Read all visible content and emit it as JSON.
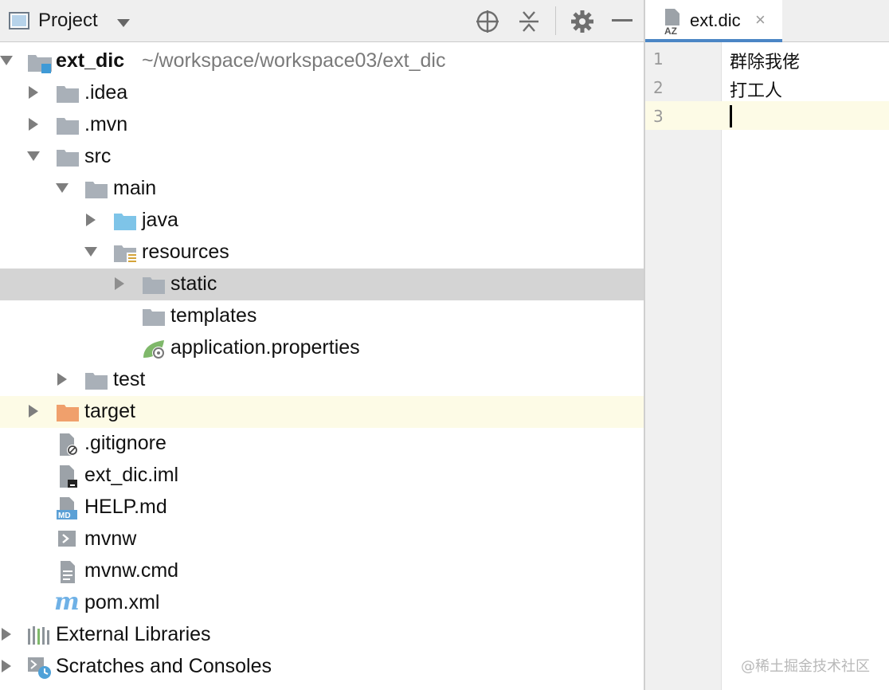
{
  "project_panel": {
    "title": "Project",
    "toolbar_icons": [
      "locate-icon",
      "collapse-all-icon",
      "gear-icon",
      "minimize-icon"
    ]
  },
  "tree": {
    "root": {
      "name": "ext_dic",
      "path": "~/workspace/workspace03/ext_dic"
    },
    "items": [
      {
        "label": ".idea"
      },
      {
        "label": ".mvn"
      },
      {
        "label": "src"
      },
      {
        "label": "main"
      },
      {
        "label": "java"
      },
      {
        "label": "resources"
      },
      {
        "label": "static"
      },
      {
        "label": "templates"
      },
      {
        "label": "application.properties"
      },
      {
        "label": "test"
      },
      {
        "label": "target"
      },
      {
        "label": ".gitignore"
      },
      {
        "label": "ext_dic.iml"
      },
      {
        "label": "HELP.md"
      },
      {
        "label": "mvnw"
      },
      {
        "label": "mvnw.cmd"
      },
      {
        "label": "pom.xml"
      },
      {
        "label": "External Libraries"
      },
      {
        "label": "Scratches and Consoles"
      }
    ]
  },
  "editor": {
    "tab": {
      "label": "ext.dic",
      "close": "×"
    },
    "lines": [
      {
        "num": "1",
        "text": "群除我佬"
      },
      {
        "num": "2",
        "text": "打工人"
      },
      {
        "num": "3",
        "text": ""
      }
    ]
  },
  "watermark": "@稀土掘金技术社区",
  "colors": {
    "selection": "#d4d4d4",
    "highlight": "#fdfbe6",
    "folder": "#a9b0b8",
    "java_folder": "#7ec4e8",
    "target_folder": "#f0a06c",
    "tab_accent": "#4b86c5"
  }
}
